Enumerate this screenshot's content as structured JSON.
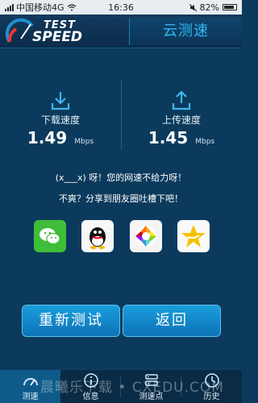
{
  "status_bar": {
    "carrier": "中国移动4G",
    "time": "16:36",
    "battery": "82%"
  },
  "header": {
    "logo_test": "TEST",
    "logo_speed": "SPEED",
    "title": "云测速"
  },
  "result": {
    "download_label": "下载速度",
    "download_value": "1.49",
    "download_unit": "Mbps",
    "upload_label": "上传速度",
    "upload_value": "1.45",
    "upload_unit": "Mbps"
  },
  "messages": {
    "line1": "(x___x) 呀！您的网速不给力呀！",
    "line2": "不爽？分享到朋友圈吐槽下吧！"
  },
  "share_icons": [
    "wechat-icon",
    "qq-icon",
    "moments-icon",
    "qzone-icon"
  ],
  "buttons": {
    "retest": "重新测试",
    "back": "返回"
  },
  "nav": [
    {
      "label": "测速",
      "icon": "speedometer-icon",
      "active": true
    },
    {
      "label": "信息",
      "icon": "info-icon",
      "active": false
    },
    {
      "label": "测速点",
      "icon": "server-icon",
      "active": false
    },
    {
      "label": "历史",
      "icon": "history-icon",
      "active": false
    }
  ],
  "watermark": "晨曦乐下载 • CXEDU.COM",
  "colors": {
    "background": "#0c3a5c",
    "accent": "#2fb8ef",
    "button": "#1a9ddc"
  }
}
